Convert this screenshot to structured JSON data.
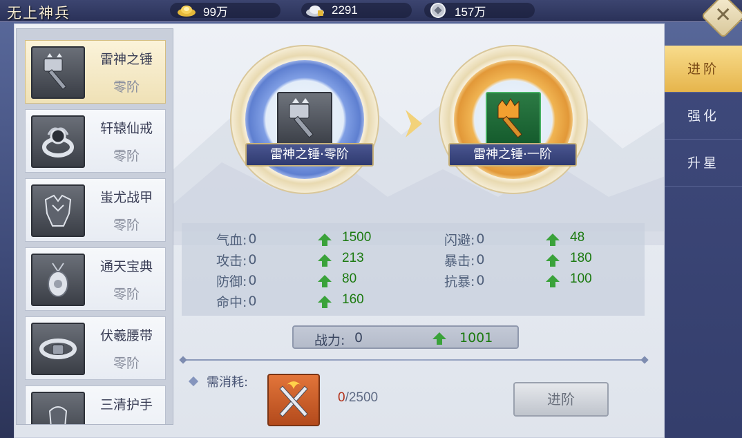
{
  "header": {
    "title": "无上神兵",
    "currencies": [
      {
        "icon": "gold-ingot-icon",
        "value": "99万"
      },
      {
        "icon": "bound-ingot-icon",
        "value": "2291"
      },
      {
        "icon": "silver-coin-icon",
        "value": "157万"
      }
    ],
    "close_label": "✕"
  },
  "equipment_list": {
    "items": [
      {
        "name": "雷神之锤",
        "tier": "零阶",
        "icon": "hammer-icon",
        "selected": true
      },
      {
        "name": "轩辕仙戒",
        "tier": "零阶",
        "icon": "ring-icon",
        "selected": false
      },
      {
        "name": "蚩尤战甲",
        "tier": "零阶",
        "icon": "armor-icon",
        "selected": false
      },
      {
        "name": "通天宝典",
        "tier": "零阶",
        "icon": "pendant-icon",
        "selected": false
      },
      {
        "name": "伏羲腰带",
        "tier": "零阶",
        "icon": "belt-icon",
        "selected": false
      },
      {
        "name": "三清护手",
        "tier": "",
        "icon": "gauntlet-icon",
        "selected": false
      }
    ]
  },
  "upgrade": {
    "current": {
      "name": "雷神之锤·零阶",
      "icon": "silver-hammer-icon"
    },
    "next": {
      "name": "雷神之锤·一阶",
      "icon": "golden-hammer-icon"
    }
  },
  "stats": {
    "rows": [
      {
        "label": "气血:",
        "current": "0",
        "gain": "1500"
      },
      {
        "label": "攻击:",
        "current": "0",
        "gain": "213"
      },
      {
        "label": "防御:",
        "current": "0",
        "gain": "80"
      },
      {
        "label": "命中:",
        "current": "0",
        "gain": "160"
      },
      {
        "label": "闪避:",
        "current": "0",
        "gain": "48"
      },
      {
        "label": "暴击:",
        "current": "0",
        "gain": "180"
      },
      {
        "label": "抗暴:",
        "current": "0",
        "gain": "100"
      }
    ]
  },
  "power": {
    "label": "战力:",
    "current": "0",
    "gain": "1001"
  },
  "cost": {
    "label": "需消耗:",
    "item_icon": "crossed-swords-material-icon",
    "have": "0",
    "need": "/2500"
  },
  "advance_button": "进阶",
  "tabs": [
    {
      "label": "进阶",
      "active": true
    },
    {
      "label": "强化",
      "active": false
    },
    {
      "label": "升星",
      "active": false
    }
  ],
  "colors": {
    "gain_green": "#1c7a10",
    "insufficient_red": "#b23018",
    "tab_active_gold": "#e6b54c",
    "nav_blue": "#3f4a7c"
  }
}
